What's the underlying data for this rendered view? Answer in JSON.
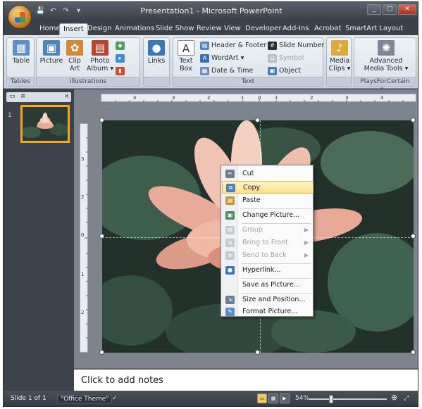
{
  "window": {
    "title": "Presentation1 - Microsoft PowerPoint",
    "controls": {
      "minimize": "_",
      "maximize": "□",
      "close": "✕"
    }
  },
  "quick_access": [
    "💾",
    "↶",
    "↷",
    "▾"
  ],
  "tabs": [
    "Home",
    "Insert",
    "Design",
    "Animations",
    "Slide Show",
    "Review",
    "View",
    "Developer",
    "Add-Ins",
    "Acrobat",
    "SmartArt Layout Des"
  ],
  "active_tab": "Insert",
  "ribbon": {
    "groups": {
      "tables": "Tables",
      "illustrations": "Illustrations",
      "links": "",
      "text": "Text",
      "media": "",
      "plays": "PlaysForCertain Pro"
    },
    "buttons": {
      "table": "Table",
      "picture": "Picture",
      "clip_art_1": "Clip",
      "clip_art_2": "Art",
      "photo_album_1": "Photo",
      "photo_album_2": "Album ▾",
      "links": "Links",
      "text_box_1": "Text",
      "text_box_2": "Box",
      "header_footer": "Header & Footer",
      "wordart": "WordArt ▾",
      "date_time": "Date & Time",
      "slide_number": "Slide Number",
      "symbol": "Symbol",
      "object": "Object",
      "media_clips_1": "Media",
      "media_clips_2": "Clips ▾",
      "advanced_media_1": "Advanced",
      "advanced_media_2": "Media Tools ▾"
    }
  },
  "left_panel": {
    "slide_number": "1",
    "close": "×"
  },
  "context_menu": {
    "items": [
      {
        "label": "Cut",
        "icon": "scissors-icon",
        "enabled": true
      },
      {
        "label": "Copy",
        "icon": "copy-icon",
        "enabled": true,
        "highlighted": true
      },
      {
        "label": "Paste",
        "icon": "paste-icon",
        "enabled": true
      },
      {
        "label": "Change Picture...",
        "icon": "change-picture-icon",
        "enabled": true
      },
      {
        "label": "Group",
        "icon": "group-icon",
        "enabled": false,
        "submenu": true
      },
      {
        "label": "Bring to Front",
        "icon": "bring-front-icon",
        "enabled": false,
        "submenu": true
      },
      {
        "label": "Send to Back",
        "icon": "send-back-icon",
        "enabled": false,
        "submenu": true
      },
      {
        "label": "Hyperlink...",
        "icon": "hyperlink-icon",
        "enabled": true
      },
      {
        "label": "Save as Picture...",
        "icon": "",
        "enabled": true
      },
      {
        "label": "Size and Position...",
        "icon": "size-icon",
        "enabled": true
      },
      {
        "label": "Format Picture...",
        "icon": "format-icon",
        "enabled": true
      }
    ]
  },
  "notes": {
    "placeholder": "Click to add notes"
  },
  "status": {
    "slide": "Slide 1 of 1",
    "theme": "\"Office Theme\"",
    "zoom": "54%",
    "zoom_level": 0.54
  },
  "colors": {
    "accent": "#f5a623",
    "highlight": "#fde08a",
    "ribbon": "#dbe2ea"
  }
}
